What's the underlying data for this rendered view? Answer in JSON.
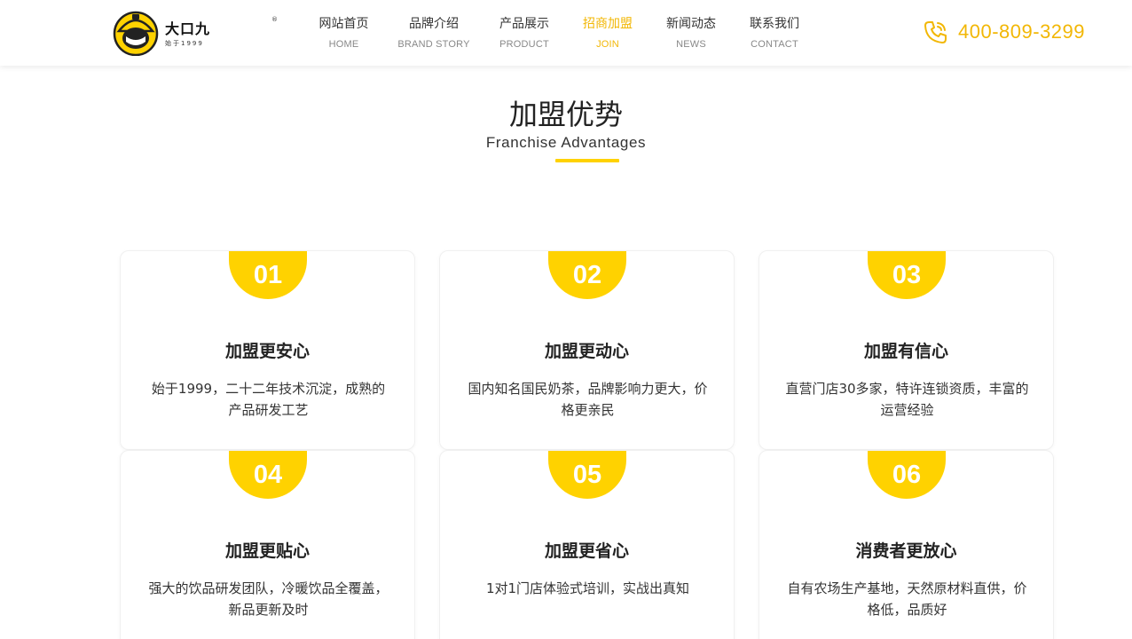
{
  "brand": {
    "name": "大口九",
    "tagline": "始于1999",
    "reg": "®"
  },
  "nav": [
    {
      "cn": "网站首页",
      "en": "HOME",
      "active": false
    },
    {
      "cn": "品牌介绍",
      "en": "BRAND STORY",
      "active": false
    },
    {
      "cn": "产品展示",
      "en": "PRODUCT",
      "active": false
    },
    {
      "cn": "招商加盟",
      "en": "JOIN",
      "active": true
    },
    {
      "cn": "新闻动态",
      "en": "NEWS",
      "active": false
    },
    {
      "cn": "联系我们",
      "en": "CONTACT",
      "active": false
    }
  ],
  "phone": "400-809-3299",
  "section": {
    "title": "加盟优势",
    "subtitle": "Franchise Advantages"
  },
  "cards": [
    {
      "num": "01",
      "title": "加盟更安心",
      "desc": "始于1999，二十二年技术沉淀，成熟的产品研发工艺"
    },
    {
      "num": "02",
      "title": "加盟更动心",
      "desc": "国内知名国民奶茶，品牌影响力更大，价格更亲民"
    },
    {
      "num": "03",
      "title": "加盟有信心",
      "desc": "直营门店30多家，特许连锁资质，丰富的运营经验"
    },
    {
      "num": "04",
      "title": "加盟更贴心",
      "desc": "强大的饮品研发团队，冷暖饮品全覆盖，新品更新及时"
    },
    {
      "num": "05",
      "title": "加盟更省心",
      "desc": "1对1门店体验式培训，实战出真知"
    },
    {
      "num": "06",
      "title": "消费者更放心",
      "desc": "自有农场生产基地，天然原材料直供，价格低，品质好"
    }
  ],
  "colors": {
    "accent": "#ffd200",
    "accent_text": "#f2b705",
    "text": "#222222"
  }
}
